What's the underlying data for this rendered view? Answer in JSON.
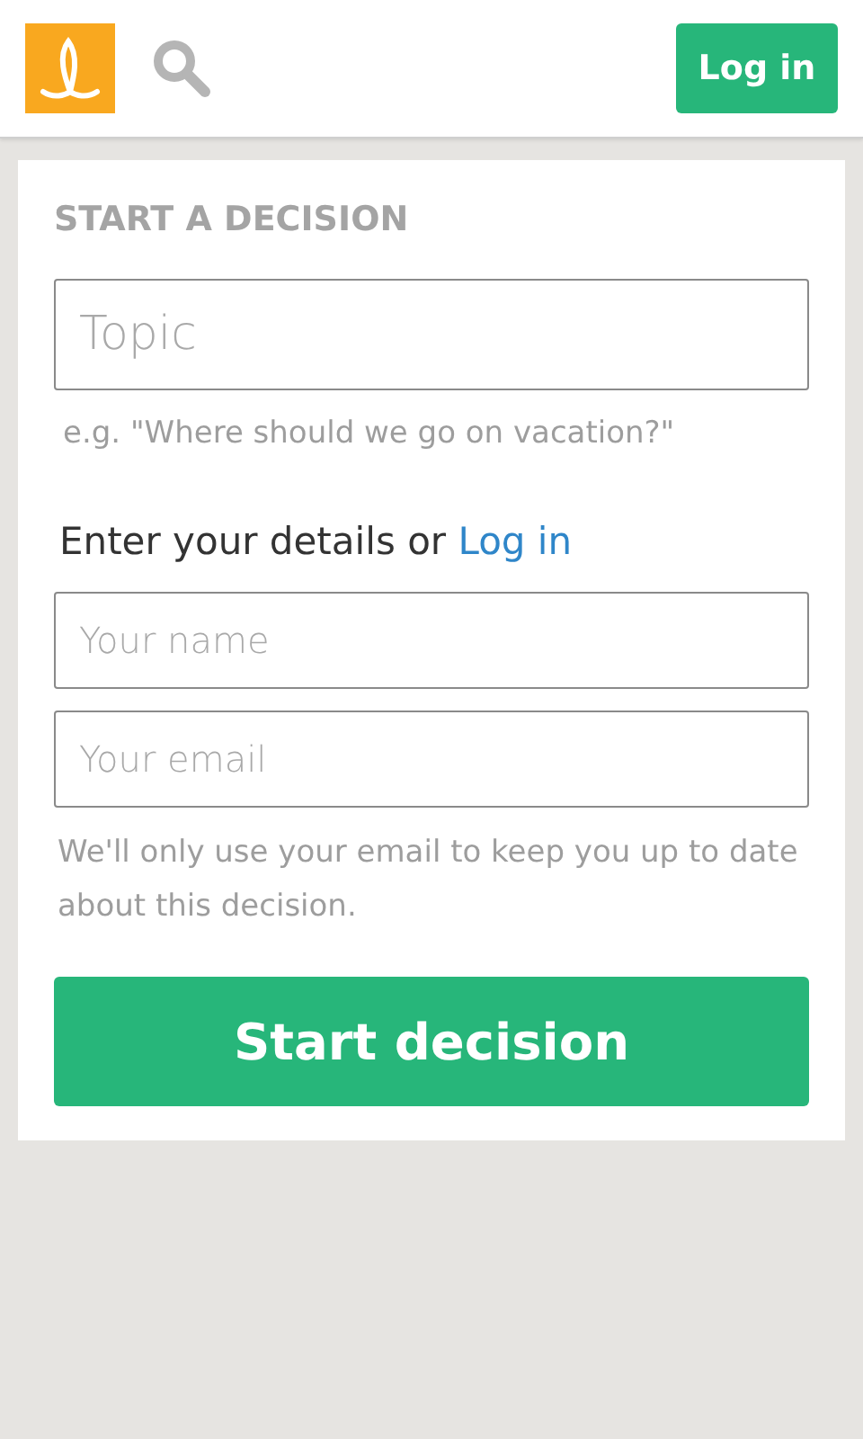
{
  "header": {
    "login_button": "Log in"
  },
  "form": {
    "title": "START A DECISION",
    "topic": {
      "placeholder": "Topic"
    },
    "topic_hint": "e.g. \"Where should we go on vacation?\"",
    "details_prompt": "Enter your details or",
    "details_link": "Log in",
    "name": {
      "placeholder": "Your name"
    },
    "email": {
      "placeholder": "Your email"
    },
    "email_note": "We'll only use your email to keep you up to date about this decision.",
    "submit_button": "Start decision"
  }
}
